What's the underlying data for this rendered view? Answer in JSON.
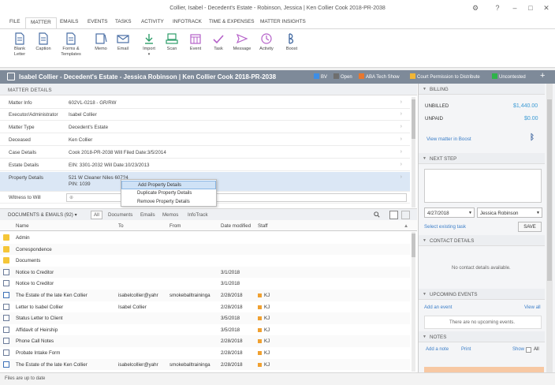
{
  "window": {
    "title": "Collier, Isabel - Decedent's Estate - Robinson, Jessica | Ken Collier Cook 2018-PR-2038",
    "help": "?",
    "minimize": "–",
    "maximize": "□",
    "close": "✕"
  },
  "tabs": [
    "FILE",
    "MATTER",
    "EMAILS",
    "EVENTS",
    "TASKS",
    "ACTIVITY",
    "INFOTRACK",
    "TIME & EXPENSES",
    "MATTER INSIGHTS"
  ],
  "ribbon": [
    {
      "name": "blank-letter",
      "label": "Blank\nLetter",
      "icon": "doc-icon",
      "color": "#4a6fa5"
    },
    {
      "name": "caption",
      "label": "Caption",
      "icon": "doc-icon",
      "color": "#4a6fa5"
    },
    {
      "name": "forms-templates",
      "label": "Forms &\nTemplates",
      "icon": "doc-icon",
      "color": "#4a6fa5"
    },
    {
      "name": "memo",
      "label": "Memo",
      "icon": "memo-icon",
      "color": "#4a6fa5"
    },
    {
      "name": "email",
      "label": "Email",
      "icon": "envelope-icon",
      "color": "#4a6fa5"
    },
    {
      "name": "import",
      "label": "Import",
      "icon": "import-icon",
      "color": "#2e9e6a"
    },
    {
      "name": "scan",
      "label": "Scan",
      "icon": "scan-icon",
      "color": "#2e9e6a"
    },
    {
      "name": "event",
      "label": "Event",
      "icon": "calendar-icon",
      "color": "#b561c9"
    },
    {
      "name": "task",
      "label": "Task",
      "icon": "check-icon",
      "color": "#b561c9"
    },
    {
      "name": "message",
      "label": "Message",
      "icon": "message-icon",
      "color": "#b561c9"
    },
    {
      "name": "activity",
      "label": "Activity",
      "icon": "activity-icon",
      "color": "#b561c9"
    },
    {
      "name": "boost",
      "label": "Boost",
      "icon": "boost-icon",
      "color": "#4a6fa5"
    }
  ],
  "matter_bar": {
    "title": "Isabel Collier - Decedent's Estate - Jessica Robinson | Ken Collier Cook 2018-PR-2038",
    "legend": [
      {
        "label": "BV",
        "color": "#3d8ee6"
      },
      {
        "label": "Open",
        "color": "#6e6e6e"
      },
      {
        "label": "ABA Tech Show",
        "color": "#e8772e"
      },
      {
        "label": "Court Permission to Distribute",
        "color": "#f2b636"
      },
      {
        "label": "Uncontested",
        "color": "#2fb34a"
      }
    ],
    "plus": "+"
  },
  "matter_details": {
    "header": "MATTER DETAILS",
    "rows": [
      {
        "label": "Matter Info",
        "value": "602VL-0218 - GR/RW"
      },
      {
        "label": "Executor/Administrator",
        "value": "Isabel Collier"
      },
      {
        "label": "Matter Type",
        "value": "Decedent's Estate"
      },
      {
        "label": "Deceased",
        "value": "Ken Collier"
      },
      {
        "label": "Case Details",
        "value": "Cook 2018-PR-2038   Will Filed Date:3/5/2014"
      },
      {
        "label": "Estate Details",
        "value": "EIN: 3301-2032   Will Date:10/23/2013"
      },
      {
        "label": "Property Details",
        "value": "521 W Cleaner Niles 607?4",
        "value2": "PIN: 1039"
      },
      {
        "label": "Witness to Will",
        "value": ""
      }
    ]
  },
  "context_menu": [
    "Add Property Details",
    "Duplicate Property Details",
    "Remove Property Details"
  ],
  "documents": {
    "header": "DOCUMENTS & EMAILS (92) ▾",
    "filters": [
      "All",
      "Documents",
      "Emails",
      "Memos",
      "InfoTrack"
    ],
    "columns": [
      "Name",
      "To",
      "From",
      "Date modified",
      "Staff"
    ],
    "rows": [
      {
        "type": "folder",
        "name": "Admin",
        "to": "",
        "from": "",
        "date": "",
        "staff": ""
      },
      {
        "type": "folder",
        "name": "Correspondence",
        "to": "",
        "from": "",
        "date": "",
        "staff": ""
      },
      {
        "type": "folder",
        "name": "Documents",
        "to": "",
        "from": "",
        "date": "",
        "staff": ""
      },
      {
        "type": "doc",
        "name": "Notice to Creditor",
        "to": "",
        "from": "",
        "date": "3/1/2018",
        "staff": ""
      },
      {
        "type": "doc",
        "name": "Notice to Creditor",
        "to": "",
        "from": "",
        "date": "3/1/2018",
        "staff": ""
      },
      {
        "type": "email",
        "name": "The Estate of the late Ken Collier",
        "to": "isabelcollier@yahr",
        "from": "smokeballtraininga",
        "date": "2/28/2018",
        "staff": "KJ"
      },
      {
        "type": "doc",
        "name": "Letter to Isabel Collier",
        "to": "Isabel Collier",
        "from": "",
        "date": "2/28/2018",
        "staff": "KJ"
      },
      {
        "type": "doc",
        "name": "Status Letter to Client",
        "to": "",
        "from": "",
        "date": "3/5/2018",
        "staff": "KJ"
      },
      {
        "type": "doc",
        "name": "Affidavit of Heirship",
        "to": "",
        "from": "",
        "date": "3/5/2018",
        "staff": "KJ"
      },
      {
        "type": "doc",
        "name": "Phone Call Notes",
        "to": "",
        "from": "",
        "date": "2/28/2018",
        "staff": "KJ"
      },
      {
        "type": "doc",
        "name": "Probate Intake Form",
        "to": "",
        "from": "",
        "date": "2/28/2018",
        "staff": "KJ"
      },
      {
        "type": "email",
        "name": "The Estate of the late Ken Collier",
        "to": "isabelcollier@yahr",
        "from": "smokeballtraininga",
        "date": "2/28/2018",
        "staff": "KJ"
      }
    ]
  },
  "status": "Files are up to date",
  "billing": {
    "header": "BILLING",
    "unbilled_label": "UNBILLED",
    "unbilled": "$1,440.00",
    "unpaid_label": "UNPAID",
    "unpaid": "$0.00",
    "link": "View matter in Boost"
  },
  "next_step": {
    "header": "NEXT STEP",
    "date": "4/27/2018",
    "assignee": "Jessica Robinson",
    "link": "Select existing task",
    "save": "SAVE"
  },
  "contact_details": {
    "header": "CONTACT DETAILS",
    "empty": "No contact details available."
  },
  "upcoming_events": {
    "header": "UPCOMING EVENTS",
    "add": "Add an event",
    "view": "View all",
    "empty": "There are no upcoming events."
  },
  "notes": {
    "header": "NOTES",
    "add": "Add a note",
    "print": "Print",
    "show": "Show",
    "all": "All"
  }
}
